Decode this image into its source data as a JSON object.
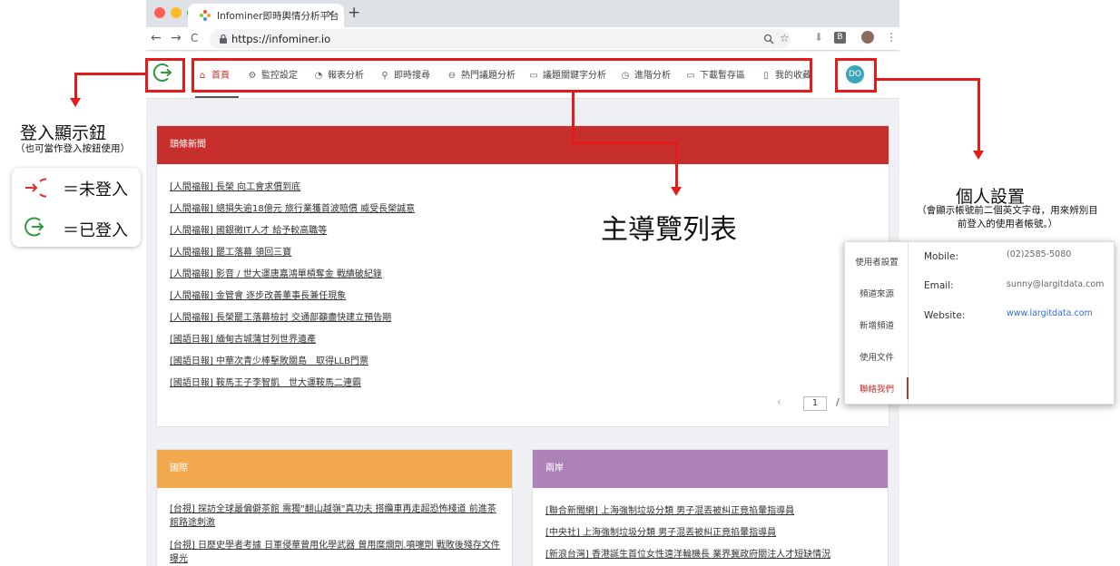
{
  "browser": {
    "tab_title": "Infominer即時輿情分析平台",
    "tab_close": "×",
    "new_tab": "+",
    "back": "←",
    "forward": "→",
    "reload": "C",
    "url": "https://infominer.io",
    "extension_label": "B",
    "menu": "⋮"
  },
  "app_nav": {
    "items": [
      {
        "icon": "home-icon",
        "label": "首頁",
        "active": true
      },
      {
        "icon": "gear-icon",
        "label": "監控設定"
      },
      {
        "icon": "pie-chart-icon",
        "label": "報表分析"
      },
      {
        "icon": "search-icon",
        "label": "即時搜尋"
      },
      {
        "icon": "minus-circle-icon",
        "label": "熱門議題分析"
      },
      {
        "icon": "folder-icon",
        "label": "議題關鍵字分析"
      },
      {
        "icon": "gauge-icon",
        "label": "進階分析"
      },
      {
        "icon": "folder-icon",
        "label": "下載暫存區"
      },
      {
        "icon": "document-icon",
        "label": "我的收藏"
      }
    ],
    "avatar_initials": "DO"
  },
  "headlines": {
    "title": "頭條新聞",
    "header_color": "#c72f2c",
    "items": [
      "[人間福報] 長榮 向工會求償到底",
      "[人間福報] 總損失逾18億元 旅行業獲首波賠償 威受長榮誠意",
      "[人間福報] 國銀徵IT人才 給予較高職等",
      "[人間福報] 罷工落幕 領回三寶",
      "[人間福報] 影音 / 世大運唐嘉鴻單槓奪金 戰績破紀錄",
      "[人間福報] 金管會 逐步改善董事長兼任現象",
      "[人間福報] 長榮罷工落幕檢討 交通部籲盡快建立預告期",
      "[國語日報] 緬甸古城蒲甘列世界遺產",
      "[國語日報] 中華次青少棒擊敗關島　取得LLB門票",
      "[國語日報] 鞍馬王子李智凱　世大運鞍馬二連霸"
    ],
    "pager_prev": "‹",
    "page": "1",
    "pager_sep": "/"
  },
  "international": {
    "title": "國際",
    "header_color": "#f2a94e",
    "items": [
      "[台視] 探訪全球最偏僻茶館 需獨\"翻山越嶺\"真功夫 搭纜車再走超恐怖棧道 前進茶館路途刺激",
      "[台視] 日歷史學者考據 日軍侵華曾用化學武器 曾用糜爛劑.噴嚏劑 戰敗後殘存文件曝光"
    ]
  },
  "cross_strait": {
    "title": "兩岸",
    "header_color": "#ad82b9",
    "items": [
      "[聯合新聞網] 上海強制垃圾分類 男子混丟被糾正竟掐暈指導員",
      "[中央社] 上海強制垃圾分類 男子混丟被糾正竟掐暈指導員",
      "[新浪台灣] 香港誕生首位女性遠洋輪機長 業界冀政府關注人才短缺情況"
    ]
  },
  "annotations": {
    "login_title": "登入顯示鈕",
    "login_subtitle": "（也可當作登入按鈕使用）",
    "not_logged_in": "＝未登入",
    "logged_in": "＝已登入",
    "main_nav_label": "主導覽列表",
    "personal_title": "個人設置",
    "personal_desc": "（會顯示帳號前二個英文字母，用來辨別目前登入的使用者帳號。）",
    "highlight_color": "#e31b1b"
  },
  "profile_card": {
    "menu": [
      "使用者設置",
      "頻道來源",
      "新增頻道",
      "使用文件",
      "聯絡我們"
    ],
    "active_index": 4,
    "fields": [
      {
        "label": "Mobile:",
        "value": "(02)2585-5080"
      },
      {
        "label": "Email:",
        "value": "sunny@largitdata.com"
      },
      {
        "label": "Website:",
        "value": "www.largitdata.com"
      }
    ]
  }
}
